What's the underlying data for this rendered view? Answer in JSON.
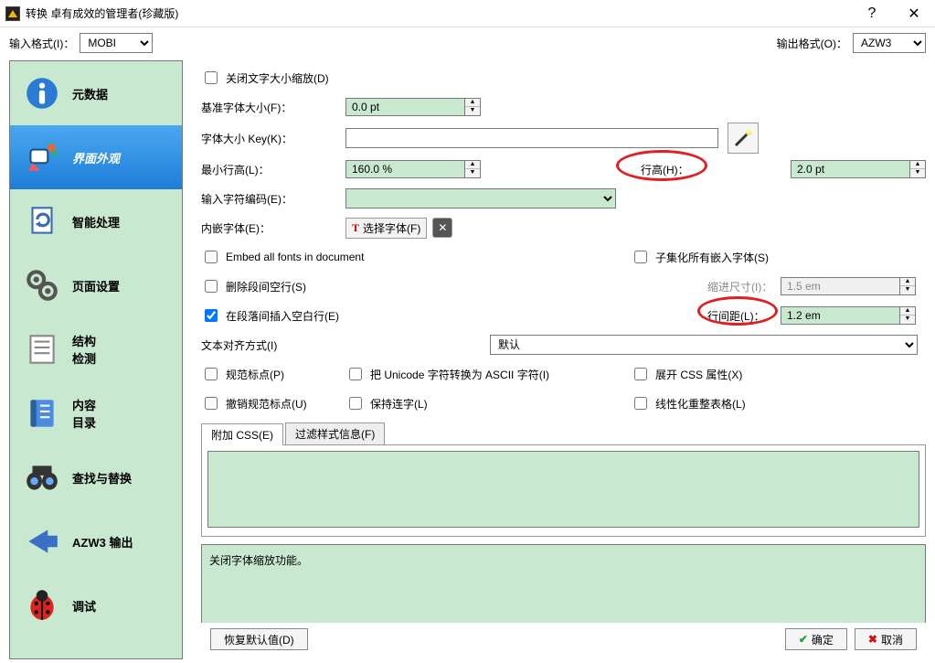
{
  "window": {
    "title": "转换 卓有成效的管理者(珍藏版)"
  },
  "formats": {
    "input_label": "输入格式(I)：",
    "input_value": "MOBI",
    "output_label": "输出格式(O)：",
    "output_value": "AZW3"
  },
  "sidebar": {
    "items": [
      {
        "label": "元数据"
      },
      {
        "label": "界面外观"
      },
      {
        "label": "智能处理"
      },
      {
        "label": "页面设置"
      },
      {
        "label": "结构\n检测"
      },
      {
        "label": "内容\n目录"
      },
      {
        "label": "查找与替换"
      },
      {
        "label": "AZW3 输出"
      },
      {
        "label": "调试"
      }
    ]
  },
  "form": {
    "disable_font_rescaling": "关闭文字大小缩放(D)",
    "base_font_size_label": "基准字体大小(F)：",
    "base_font_size_value": "0.0 pt",
    "font_size_key_label": "字体大小 Key(K)：",
    "font_size_key_value": "",
    "min_line_height_label": "最小行高(L)：",
    "min_line_height_value": "160.0 %",
    "line_height_label": "行高(H)：",
    "line_height_value": "2.0 pt",
    "input_encoding_label": "输入字符编码(E)：",
    "input_encoding_value": "",
    "embed_font_label": "内嵌字体(E)：",
    "choose_font_btn": "选择字体(F)",
    "embed_all_fonts": "Embed all fonts in document",
    "subset_fonts": "子集化所有嵌入字体(S)",
    "remove_para_spacing": "删除段间空行(S)",
    "indent_size_label": "缩进尺寸(I)：",
    "indent_size_value": "1.5 em",
    "insert_blank_line": "在段落间插入空白行(E)",
    "line_spacing_label": "行间距(L)：",
    "line_spacing_value": "1.2 em",
    "text_align_label": "文本对齐方式(I)",
    "text_align_value": "默认",
    "smarten_punct": "规范标点(P)",
    "transliterate_unicode": "把 Unicode 字符转换为 ASCII 字符(I)",
    "expand_css": "展开 CSS 属性(X)",
    "unsmarten_punct": "撤销规范标点(U)",
    "keep_ligatures": "保持连字(L)",
    "linearize_tables": "线性化重整表格(L)",
    "tabs": {
      "extra_css": "附加 CSS(E)",
      "filter_style": "过滤样式信息(F)"
    },
    "css_value": ""
  },
  "hint": {
    "text": "关闭字体缩放功能。"
  },
  "buttons": {
    "restore_defaults": "恢复默认值(D)",
    "ok": "确定",
    "cancel": "取消"
  }
}
